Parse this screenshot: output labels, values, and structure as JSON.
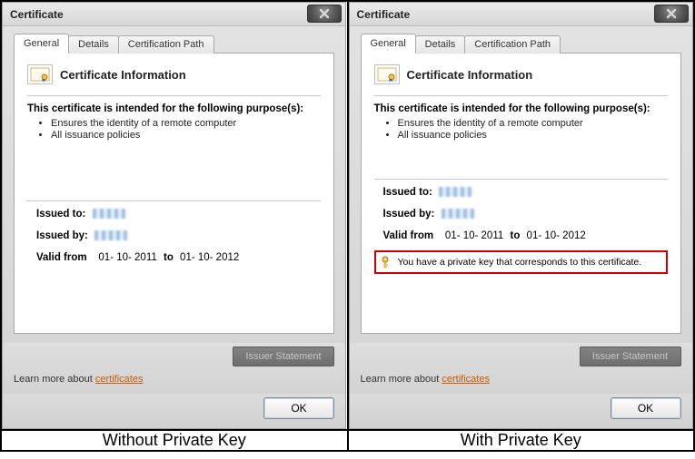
{
  "left": {
    "window_title": "Certificate",
    "tabs": {
      "general": "General",
      "details": "Details",
      "certpath": "Certification Path"
    },
    "cert_info_title": "Certificate Information",
    "intended_heading": "This certificate is intended for the following purpose(s):",
    "purposes": [
      "Ensures the identity of a remote computer",
      "All issuance policies"
    ],
    "issued_to_label": "Issued to:",
    "issued_by_label": "Issued by:",
    "valid_from_label": "Valid from",
    "valid_from_value": "01- 10- 2011",
    "valid_to_label": "to",
    "valid_to_value": "01- 10- 2012",
    "issuer_statement_label": "Issuer Statement",
    "learn_more_prefix": "Learn more about ",
    "learn_more_link": "certificates",
    "ok_label": "OK",
    "caption": "Without Private Key"
  },
  "right": {
    "window_title": "Certificate",
    "tabs": {
      "general": "General",
      "details": "Details",
      "certpath": "Certification Path"
    },
    "cert_info_title": "Certificate Information",
    "intended_heading": "This certificate is intended for the following purpose(s):",
    "purposes": [
      "Ensures the identity of a remote computer",
      "All issuance policies"
    ],
    "issued_to_label": "Issued to:",
    "issued_by_label": "Issued by:",
    "valid_from_label": "Valid from",
    "valid_from_value": "01- 10- 2011",
    "valid_to_label": "to",
    "valid_to_value": "01- 10- 2012",
    "private_key_text": "You have a private key that corresponds to this certificate.",
    "issuer_statement_label": "Issuer Statement",
    "learn_more_prefix": "Learn more about ",
    "learn_more_link": "certificates",
    "ok_label": "OK",
    "caption": "With Private Key"
  }
}
